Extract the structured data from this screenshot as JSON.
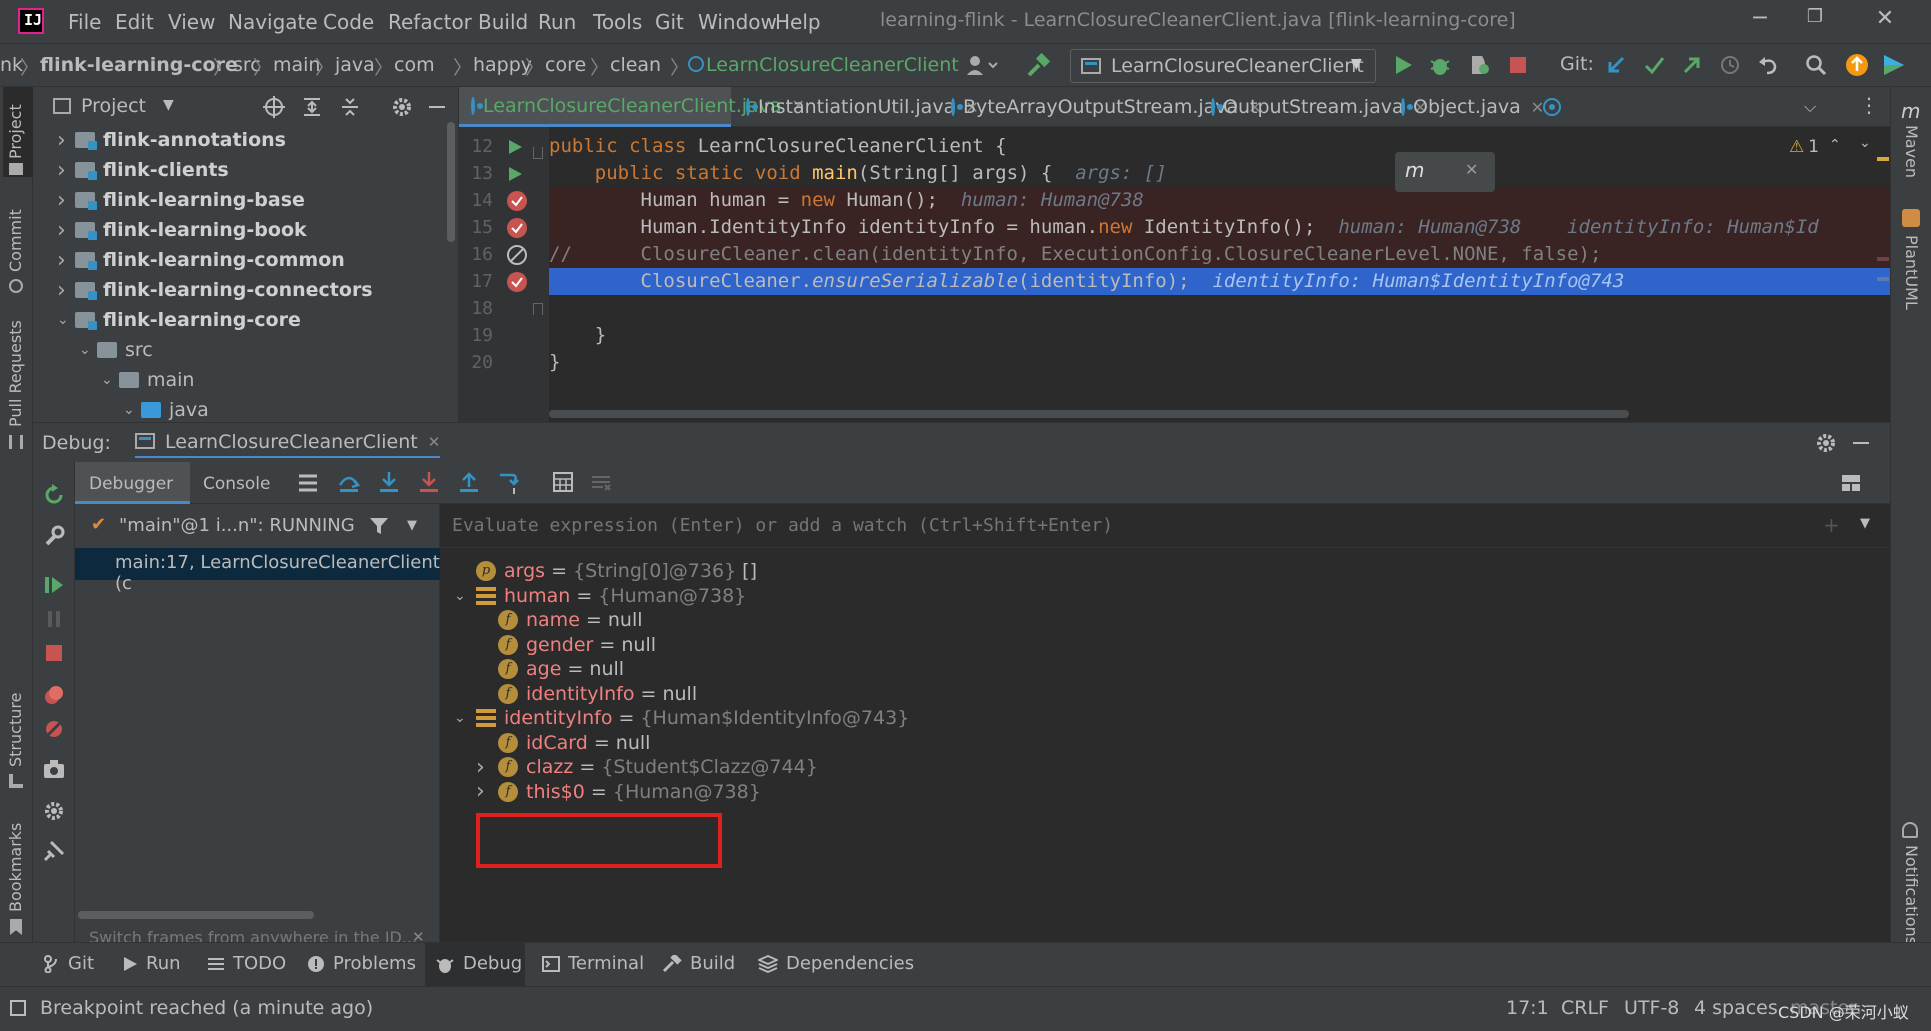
{
  "window": {
    "title": "learning-flink - LearnClosureCleanerClient.java [flink-learning-core]",
    "menu": [
      "File",
      "Edit",
      "View",
      "Navigate",
      "Code",
      "Refactor",
      "Build",
      "Run",
      "Tools",
      "Git",
      "Window",
      "Help"
    ]
  },
  "breadcrumbs": [
    "nk",
    "flink-learning-core",
    "src",
    "main",
    "java",
    "com",
    "happy",
    "core",
    "clean",
    "LearnClosureCleanerClient"
  ],
  "run_config": "LearnClosureCleanerClient",
  "git_label": "Git:",
  "project_panel": {
    "title": "Project",
    "tree": [
      {
        "label": "flink-annotations",
        "level": 0,
        "expanded": false,
        "bold": true
      },
      {
        "label": "flink-clients",
        "level": 0,
        "expanded": false,
        "bold": true
      },
      {
        "label": "flink-learning-base",
        "level": 0,
        "expanded": false,
        "bold": true
      },
      {
        "label": "flink-learning-book",
        "level": 0,
        "expanded": false,
        "bold": true
      },
      {
        "label": "flink-learning-common",
        "level": 0,
        "expanded": false,
        "bold": true
      },
      {
        "label": "flink-learning-connectors",
        "level": 0,
        "expanded": false,
        "bold": true
      },
      {
        "label": "flink-learning-core",
        "level": 0,
        "expanded": true,
        "bold": true
      },
      {
        "label": "src",
        "level": 1,
        "expanded": true,
        "bold": false
      },
      {
        "label": "main",
        "level": 2,
        "expanded": true,
        "bold": false
      },
      {
        "label": "java",
        "level": 3,
        "expanded": true,
        "bold": false
      }
    ]
  },
  "tabs": [
    {
      "label": "LearnClosureCleanerClient.java",
      "active": true
    },
    {
      "label": "InstantiationUtil.java",
      "active": false
    },
    {
      "label": "ByteArrayOutputStream.java",
      "active": false
    },
    {
      "label": "OutputStream.java",
      "active": false
    },
    {
      "label": "Object.java",
      "active": false
    }
  ],
  "editor": {
    "warnings": "1",
    "lines": [
      {
        "n": "12",
        "run": true,
        "bp": null,
        "code": [
          [
            "kw",
            "public class "
          ],
          [
            "",
            "LearnClosureCleanerClient {"
          ]
        ],
        "hint": ""
      },
      {
        "n": "13",
        "run": true,
        "bp": null,
        "code": [
          [
            "",
            "    "
          ],
          [
            "kw",
            "public static void "
          ],
          [
            "fn",
            "main"
          ],
          [
            "",
            "(String[] args) {  "
          ]
        ],
        "hint": "args: []"
      },
      {
        "n": "14",
        "run": false,
        "bp": "check",
        "code": [
          [
            "",
            "        Human human = "
          ],
          [
            "kw",
            "new "
          ],
          [
            "",
            "Human();  "
          ]
        ],
        "hint": "human: Human@738"
      },
      {
        "n": "15",
        "run": false,
        "bp": "check",
        "code": [
          [
            "",
            "        Human.IdentityInfo identityInfo = human."
          ],
          [
            "kw",
            "new "
          ],
          [
            "",
            "IdentityInfo();  "
          ]
        ],
        "hint": "human: Human@738    identityInfo: Human$Id"
      },
      {
        "n": "16",
        "run": false,
        "bp": "disabled",
        "code": [
          [
            "cmt",
            "//      ClosureCleaner.clean(identityInfo, ExecutionConfig.ClosureCleanerLevel.NONE, false);"
          ]
        ],
        "hint": ""
      },
      {
        "n": "17",
        "run": false,
        "bp": "check",
        "code": [
          [
            "",
            "        ClosureCleaner."
          ],
          [
            "it",
            "ensureSerializable"
          ],
          [
            "",
            "(identityInfo);  "
          ]
        ],
        "hint": "identityInfo: Human$IdentityInfo@743"
      },
      {
        "n": "18",
        "run": false,
        "bp": null,
        "code": [],
        "hint": ""
      },
      {
        "n": "19",
        "run": false,
        "bp": null,
        "code": [
          [
            "",
            "    }"
          ]
        ],
        "hint": ""
      },
      {
        "n": "20",
        "run": false,
        "bp": null,
        "code": [
          [
            "",
            "}"
          ]
        ],
        "hint": ""
      }
    ]
  },
  "debug": {
    "label": "Debug:",
    "session": "LearnClosureCleanerClient",
    "tabs": [
      "Debugger",
      "Console"
    ],
    "thread": "\"main\"@1 i...n\": RUNNING",
    "frame": "main:17, LearnClosureCleanerClient (c",
    "switch_hint": "Switch frames from anywhere in the ID...",
    "eval_placeholder": "Evaluate expression (Enter) or add a watch (Ctrl+Shift+Enter)",
    "variables": [
      {
        "level": 0,
        "expand": "none",
        "icon": "p",
        "name": "args",
        "type": "{String[0]@736}",
        "value": "[]"
      },
      {
        "level": 0,
        "expand": "open",
        "icon": "list",
        "name": "human",
        "type": "{Human@738}",
        "value": ""
      },
      {
        "level": 1,
        "expand": "none",
        "icon": "f",
        "name": "name",
        "type": "",
        "value": "null"
      },
      {
        "level": 1,
        "expand": "none",
        "icon": "f",
        "name": "gender",
        "type": "",
        "value": "null"
      },
      {
        "level": 1,
        "expand": "none",
        "icon": "f",
        "name": "age",
        "type": "",
        "value": "null"
      },
      {
        "level": 1,
        "expand": "none",
        "icon": "f",
        "name": "identityInfo",
        "type": "",
        "value": "null"
      },
      {
        "level": 0,
        "expand": "open",
        "icon": "list",
        "name": "identityInfo",
        "type": "{Human$IdentityInfo@743}",
        "value": ""
      },
      {
        "level": 1,
        "expand": "none",
        "icon": "f",
        "name": "idCard",
        "type": "",
        "value": "null"
      },
      {
        "level": 1,
        "expand": "closed",
        "icon": "f",
        "name": "clazz",
        "type": "{Student$Clazz@744}",
        "value": ""
      },
      {
        "level": 1,
        "expand": "closed",
        "icon": "f",
        "name": "this$0",
        "type": "{Human@738}",
        "value": "",
        "highlight": true
      }
    ]
  },
  "left_stripe": [
    "Project",
    "Commit",
    "Pull Requests",
    "Structure",
    "Bookmarks"
  ],
  "right_stripe": [
    "Maven",
    "PlantUML",
    "Notifications"
  ],
  "tool_windows": [
    "Git",
    "Run",
    "TODO",
    "Problems",
    "Debug",
    "Terminal",
    "Build",
    "Dependencies"
  ],
  "status": {
    "message": "Breakpoint reached (a minute ago)",
    "position": "17:1",
    "line_sep": "CRLF",
    "encoding": "UTF-8",
    "indent": "4 spaces",
    "branch": "master",
    "watermark": "CSDN @荣河小蚁"
  },
  "colors": {
    "accent": "#4a88c7",
    "highlight_box": "#e0201a",
    "selection": "#2f65ca",
    "bp_line": "#3a2323"
  }
}
